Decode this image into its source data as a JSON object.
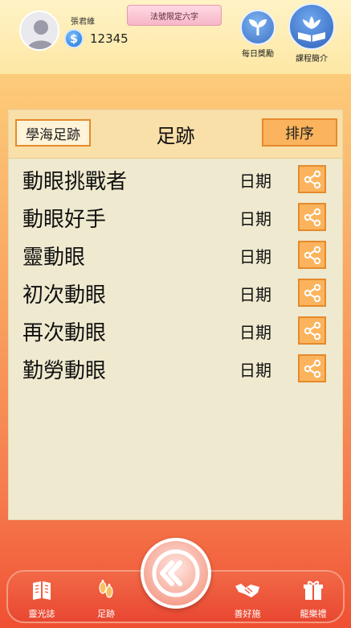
{
  "header": {
    "user_name": "張君維",
    "coin_count": "12345",
    "title_badge": "法號限定六字",
    "daily_reward_label": "每日獎勵",
    "course_intro_label": "課程簡介"
  },
  "panel": {
    "tab_label": "學海足跡",
    "title": "足跡",
    "sort_label": "排序",
    "rows": [
      {
        "name": "動眼挑戰者",
        "date": "日期"
      },
      {
        "name": "動眼好手",
        "date": "日期"
      },
      {
        "name": "靈動眼",
        "date": "日期"
      },
      {
        "name": "初次動眼",
        "date": "日期"
      },
      {
        "name": "再次動眼",
        "date": "日期"
      },
      {
        "name": "勤勞動眼",
        "date": "日期"
      }
    ]
  },
  "nav": {
    "items": [
      {
        "label": "靈光誌",
        "icon": "book-icon"
      },
      {
        "label": "足跡",
        "icon": "footprint-icon"
      },
      {
        "label": "善好施",
        "icon": "handshake-icon"
      },
      {
        "label": "龍樂禮",
        "icon": "gift-icon"
      }
    ],
    "center_icon": "rewind-icon"
  },
  "colors": {
    "accent": "#fbb45d",
    "border": "#e58a2b",
    "nav_bg": "#ec5338"
  }
}
